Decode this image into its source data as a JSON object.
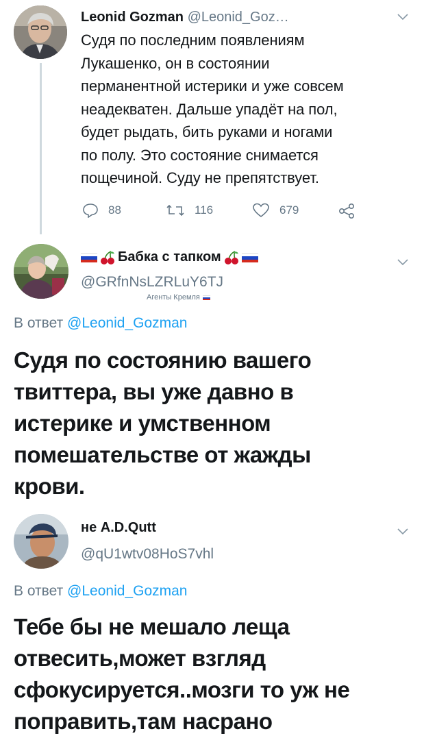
{
  "tweets": [
    {
      "name": "Leonid Gozman",
      "handle": "@Leonid_Goz…",
      "text_lines": [
        "Судя по последним появлениям",
        "Лукашенко, он в состоянии",
        "перманентной истерики и уже совсем",
        "неадекватен. Дальше упадёт на пол,",
        "будет рыдать, бить руками и ногами",
        "по полу. Это состояние снимается",
        "пощечиной. Суду не препятствует."
      ],
      "replies": "88",
      "retweets": "116",
      "likes": "679"
    },
    {
      "name": "Бабка с тапком",
      "handle": "@GRfnNsLZRLuY6TJ",
      "tagline": "Агенты Кремля",
      "reply_prefix": "В ответ",
      "reply_mention": "@Leonid_Gozman",
      "text_lines": [
        "Судя по состоянию вашего",
        "твиттера, вы уже давно в",
        "истерике и умственном",
        "помешательстве от жажды",
        "крови."
      ]
    },
    {
      "name": "не A.D.Qutt",
      "handle": "@qU1wtv08HoS7vhl",
      "reply_prefix": "В ответ",
      "reply_mention": "@Leonid_Gozman",
      "text_lines": [
        "Тебе бы не мешало леща",
        "отвесить,может взгляд",
        "сфокусируется..мозги то уж не",
        "поправить,там насрано"
      ]
    }
  ],
  "colors": {
    "text": "#14171a",
    "secondary": "#657786",
    "link": "#1da1f2",
    "thread_line": "#cfd9de"
  },
  "icons": [
    "reply-icon",
    "retweet-icon",
    "like-icon",
    "share-icon",
    "chevron-down-icon",
    "cherry-icon",
    "russian-flag-icon"
  ]
}
